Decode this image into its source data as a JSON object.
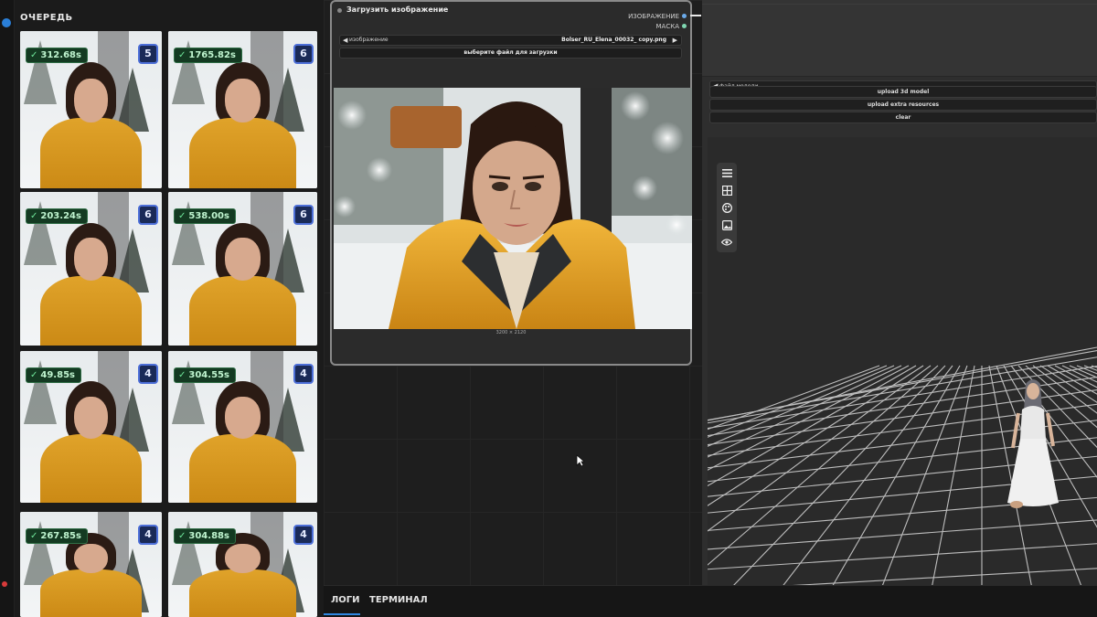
{
  "queue": {
    "title": "ОЧЕРЕДЬ",
    "items": [
      {
        "time": "312.68s",
        "count": "5"
      },
      {
        "time": "1765.82s",
        "count": "6"
      },
      {
        "time": "203.24s",
        "count": "6"
      },
      {
        "time": "538.00s",
        "count": "6"
      },
      {
        "time": "49.85s",
        "count": "4"
      },
      {
        "time": "304.55s",
        "count": "4"
      },
      {
        "time": "267.85s",
        "count": "4"
      },
      {
        "time": "304.88s",
        "count": "4"
      }
    ]
  },
  "load_image_node": {
    "title": "Загрузить изображение",
    "outputs": [
      "ИЗОБРАЖЕНИЕ",
      "МАСКА"
    ],
    "image_widget_label": "изображение",
    "image_filename": "Bolser_RU_Elena_00032_ copy.png",
    "choose_file_button": "выберите файл для загрузки",
    "dimensions": "3200 × 2120"
  },
  "model_panel": {
    "file_label": "файл модели",
    "upload_3d": "upload 3d model",
    "upload_extra": "upload extra resources",
    "clear": "clear",
    "tools": [
      "menu-icon",
      "grid-icon",
      "palette-icon",
      "image-icon",
      "eye-icon"
    ]
  },
  "bottom_tabs": [
    "ЛОГИ",
    "ТЕРМИНАЛ"
  ],
  "colors": {
    "accent": "#2f86e0",
    "success": "#6fe69a",
    "count_border": "#4d6fd8",
    "jacket": "#d9981e"
  }
}
